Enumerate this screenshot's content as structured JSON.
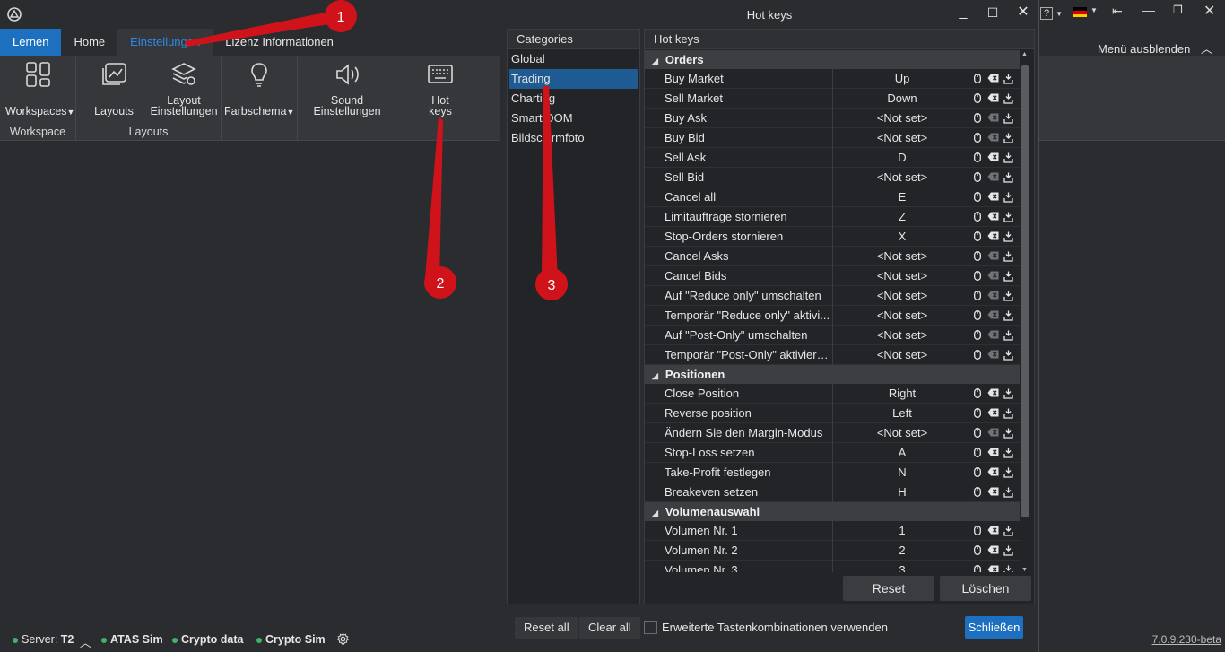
{
  "app": {
    "tabs": [
      "Lernen",
      "Home",
      "Einstellungen",
      "Lizenz Informationen"
    ],
    "menu_toggle": "Menü ausblenden",
    "ribbon": {
      "workspaces": "Workspaces",
      "workspace_group": "Workspace",
      "layouts": "Layouts",
      "layout_settings_1": "Layout",
      "layout_settings_2": "Einstellungen",
      "layouts_group": "Layouts",
      "color_scheme": "Farbschema",
      "sound_1": "Sound",
      "sound_2": "Einstellungen",
      "hotkeys_1": "Hot",
      "hotkeys_2": "keys"
    },
    "status": {
      "server_label": "Server:",
      "server_value": "T2",
      "items": [
        "ATAS Sim",
        "Crypto data",
        "Crypto Sim"
      ],
      "status_color": "#3fb36a"
    },
    "version": "7.0.9.230-beta"
  },
  "dialog": {
    "title": "Hot keys",
    "categories_header": "Categories",
    "categories": [
      "Global",
      "Trading",
      "Charting",
      "Smart DOM",
      "Bildschirmfoto"
    ],
    "selected_category": "Trading",
    "hotkeys_header": "Hot keys",
    "groups": [
      {
        "name": "Orders",
        "rows": [
          {
            "action": "Buy Market",
            "key": "Up",
            "set": true
          },
          {
            "action": "Sell Market",
            "key": "Down",
            "set": true
          },
          {
            "action": "Buy Ask",
            "key": "<Not set>",
            "set": false
          },
          {
            "action": "Buy Bid",
            "key": "<Not set>",
            "set": false
          },
          {
            "action": "Sell Ask",
            "key": "D",
            "set": true
          },
          {
            "action": "Sell Bid",
            "key": "<Not set>",
            "set": false
          },
          {
            "action": "Cancel all",
            "key": "E",
            "set": true
          },
          {
            "action": "Limitaufträge stornieren",
            "key": "Z",
            "set": true
          },
          {
            "action": "Stop-Orders stornieren",
            "key": "X",
            "set": true
          },
          {
            "action": "Cancel Asks",
            "key": "<Not set>",
            "set": false
          },
          {
            "action": "Cancel Bids",
            "key": "<Not set>",
            "set": false
          },
          {
            "action": "Auf \"Reduce only\" umschalten",
            "key": "<Not set>",
            "set": false
          },
          {
            "action": "Temporär \"Reduce only\" aktivi...",
            "key": "<Not set>",
            "set": false
          },
          {
            "action": "Auf \"Post-Only\" umschalten",
            "key": "<Not set>",
            "set": false
          },
          {
            "action": "Temporär \"Post-Only\" aktiviere...",
            "key": "<Not set>",
            "set": false
          }
        ]
      },
      {
        "name": "Positionen",
        "rows": [
          {
            "action": "Close Position",
            "key": "Right",
            "set": true
          },
          {
            "action": "Reverse position",
            "key": "Left",
            "set": true
          },
          {
            "action": "Ändern Sie den Margin-Modus",
            "key": "<Not set>",
            "set": false
          },
          {
            "action": "Stop-Loss setzen",
            "key": "A",
            "set": true
          },
          {
            "action": "Take-Profit festlegen",
            "key": "N",
            "set": true
          },
          {
            "action": "Breakeven setzen",
            "key": "H",
            "set": true
          }
        ]
      },
      {
        "name": "Volumenauswahl",
        "rows": [
          {
            "action": "Volumen Nr. 1",
            "key": "1",
            "set": true
          },
          {
            "action": "Volumen Nr. 2",
            "key": "2",
            "set": true
          },
          {
            "action": "Volumen Nr. 3",
            "key": "3",
            "set": true
          }
        ]
      }
    ],
    "reset": "Reset",
    "delete": "Löschen",
    "reset_all": "Reset all",
    "clear_all": "Clear all",
    "extended_checkbox": "Erweiterte Tastenkombinationen verwenden",
    "close": "Schließen"
  },
  "annotations": [
    "1",
    "2",
    "3"
  ],
  "colors": {
    "accent": "#1d6fbf",
    "annotation": "#d0131b",
    "link_text": "#2e8ae6"
  }
}
